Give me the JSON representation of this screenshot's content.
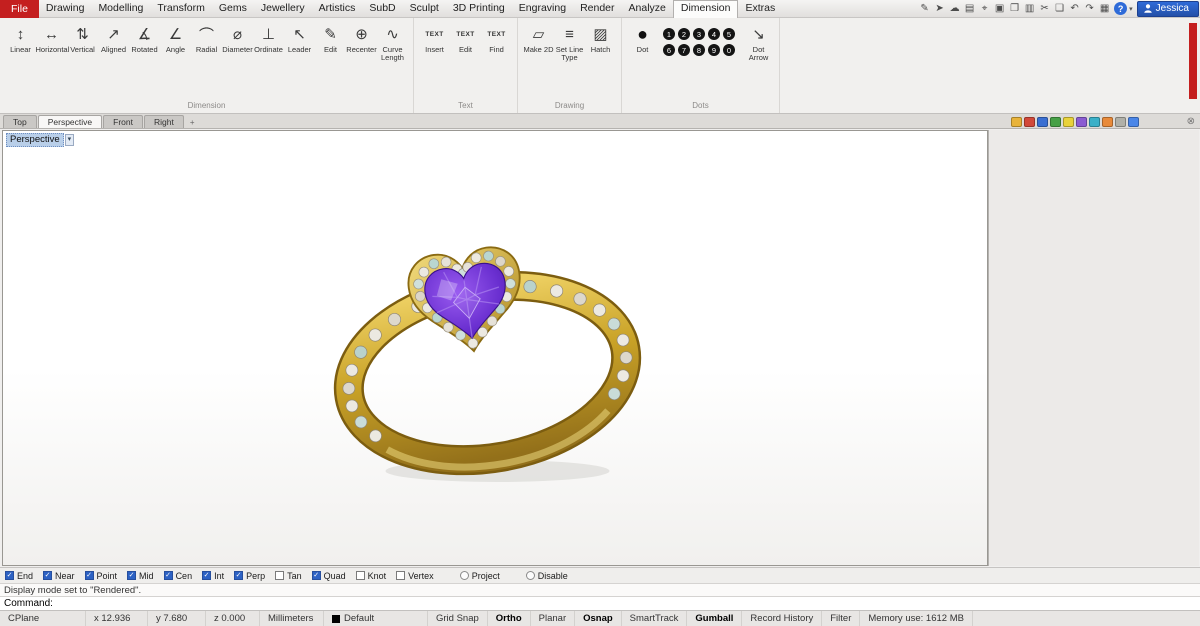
{
  "colors": {
    "accent_red": "#c41f1f",
    "selection_blue": "#2d62c4",
    "user_blue": "#2f6bd8",
    "gold": "#c9a227",
    "gem_purple": "#6a2fd0"
  },
  "titlebar": {
    "file_label": "File",
    "menus": [
      "Drawing",
      "Modelling",
      "Transform",
      "Gems",
      "Jewellery",
      "Artistics",
      "SubD",
      "Sculpt",
      "3D Printing",
      "Engraving",
      "Render",
      "Analyze",
      "Dimension",
      "Extras"
    ],
    "active_menu": "Dimension",
    "user": "Jessica",
    "help_glyph": "?",
    "caret_glyph": "▾",
    "icons": [
      {
        "name": "annotate-pen-icon",
        "glyph": "✎"
      },
      {
        "name": "pointer-icon",
        "glyph": "➤"
      },
      {
        "name": "cloud-icon",
        "glyph": "☁"
      },
      {
        "name": "notes-panel-icon",
        "glyph": "▤"
      },
      {
        "name": "mic-icon",
        "glyph": "⌖"
      },
      {
        "name": "screenshot-icon",
        "glyph": "▣"
      },
      {
        "name": "clipboard-copy-icon",
        "glyph": "❐"
      },
      {
        "name": "paste-special-icon",
        "glyph": "▥"
      },
      {
        "name": "cut-icon",
        "glyph": "✂"
      },
      {
        "name": "copy-icon",
        "glyph": "❏"
      },
      {
        "name": "undo-icon",
        "glyph": "↶"
      },
      {
        "name": "redo-icon",
        "glyph": "↷"
      },
      {
        "name": "save-icon",
        "glyph": "▦"
      }
    ]
  },
  "ribbon": {
    "groups": [
      {
        "label": "Dimension",
        "buttons": [
          {
            "label": "Linear",
            "glyph": "↕"
          },
          {
            "label": "Horizontal",
            "glyph": "↔"
          },
          {
            "label": "Vertical",
            "glyph": "⇅"
          },
          {
            "label": "Aligned",
            "glyph": "↗"
          },
          {
            "label": "Rotated",
            "glyph": "∡"
          },
          {
            "label": "Angle",
            "glyph": "∠"
          },
          {
            "label": "Radial",
            "glyph": "⌒"
          },
          {
            "label": "Diameter",
            "glyph": "⌀"
          },
          {
            "label": "Ordinate",
            "glyph": "⊥"
          },
          {
            "label": "Leader",
            "glyph": "↖"
          },
          {
            "label": "Edit",
            "glyph": "✎"
          },
          {
            "label": "Recenter",
            "glyph": "⊕"
          },
          {
            "label": "Curve Length",
            "glyph": "∿"
          }
        ]
      },
      {
        "label": "Text",
        "buttons": [
          {
            "label": "Insert",
            "glyph": "TEXT"
          },
          {
            "label": "Edit",
            "glyph": "TEXT"
          },
          {
            "label": "Find",
            "glyph": "TEXT"
          }
        ]
      },
      {
        "label": "Drawing",
        "buttons": [
          {
            "label": "Make 2D",
            "glyph": "▱"
          },
          {
            "label": "Set Line Type",
            "glyph": "≡"
          },
          {
            "label": "Hatch",
            "glyph": "▨"
          }
        ]
      },
      {
        "label": "Dots",
        "buttons": [
          {
            "label": "Dot",
            "glyph": "●"
          }
        ],
        "digits": [
          "1",
          "2",
          "3",
          "4",
          "5",
          "6",
          "7",
          "8",
          "9",
          "0"
        ],
        "arrow": {
          "label": "Dot Arrow",
          "glyph": "↘"
        }
      }
    ]
  },
  "viewport": {
    "tabs": [
      {
        "label": "Top",
        "active": false
      },
      {
        "label": "Perspective",
        "active": true
      },
      {
        "label": "Front",
        "active": false
      },
      {
        "label": "Right",
        "active": false
      }
    ],
    "add_tab_glyph": "+",
    "view_label": "Perspective",
    "model": {
      "description": "gold ring with heart-cut purple gem, diamond halo and pave band",
      "metal_color": "#c9a227",
      "gem_color": "#6a2fd0"
    }
  },
  "side_panel": {
    "close_glyph": "⊗",
    "tools": [
      {
        "name": "properties-panel-icon",
        "color": "#e8b33a"
      },
      {
        "name": "layers-panel-icon",
        "color": "#d2493a"
      },
      {
        "name": "display-panel-icon",
        "color": "#3a6fd2"
      },
      {
        "name": "help-panel-icon",
        "color": "#46a046"
      },
      {
        "name": "notes-panel-icon",
        "color": "#e8d23a"
      },
      {
        "name": "materials-panel-icon",
        "color": "#8a5cd2"
      },
      {
        "name": "libraries-panel-icon",
        "color": "#3ab0c8"
      },
      {
        "name": "sun-panel-icon",
        "color": "#e88a3a"
      },
      {
        "name": "named-views-panel-icon",
        "color": "#b0b0a8"
      },
      {
        "name": "web-panel-icon",
        "color": "#4a86e8"
      }
    ]
  },
  "osnap": {
    "items": [
      {
        "label": "End",
        "checked": true
      },
      {
        "label": "Near",
        "checked": true
      },
      {
        "label": "Point",
        "checked": true
      },
      {
        "label": "Mid",
        "checked": true
      },
      {
        "label": "Cen",
        "checked": true
      },
      {
        "label": "Int",
        "checked": true
      },
      {
        "label": "Perp",
        "checked": true
      },
      {
        "label": "Tan",
        "checked": false
      },
      {
        "label": "Quad",
        "checked": true
      },
      {
        "label": "Knot",
        "checked": false
      },
      {
        "label": "Vertex",
        "checked": false
      },
      {
        "label": "Project",
        "checked": false,
        "round": true,
        "gap_before": true
      },
      {
        "label": "Disable",
        "checked": false,
        "round": true,
        "gap_before": true
      }
    ]
  },
  "command": {
    "history": "Display mode set to \"Rendered\".",
    "prompt": "Command:"
  },
  "statusbar": {
    "items": [
      {
        "label": "CPlane",
        "w": 86
      },
      {
        "label": "x 12.936",
        "w": 62
      },
      {
        "label": "y 7.680",
        "w": 58
      },
      {
        "label": "z 0.000",
        "w": 54
      },
      {
        "label": "Millimeters",
        "w": 64
      },
      {
        "label": "Default",
        "swatch": true,
        "w": 104
      },
      {
        "label": "Grid Snap"
      },
      {
        "label": "Ortho",
        "active": true
      },
      {
        "label": "Planar"
      },
      {
        "label": "Osnap",
        "active": true
      },
      {
        "label": "SmartTrack"
      },
      {
        "label": "Gumball",
        "active": true
      },
      {
        "label": "Record History"
      },
      {
        "label": "Filter"
      },
      {
        "label": "Memory use: 1612 MB"
      }
    ]
  }
}
